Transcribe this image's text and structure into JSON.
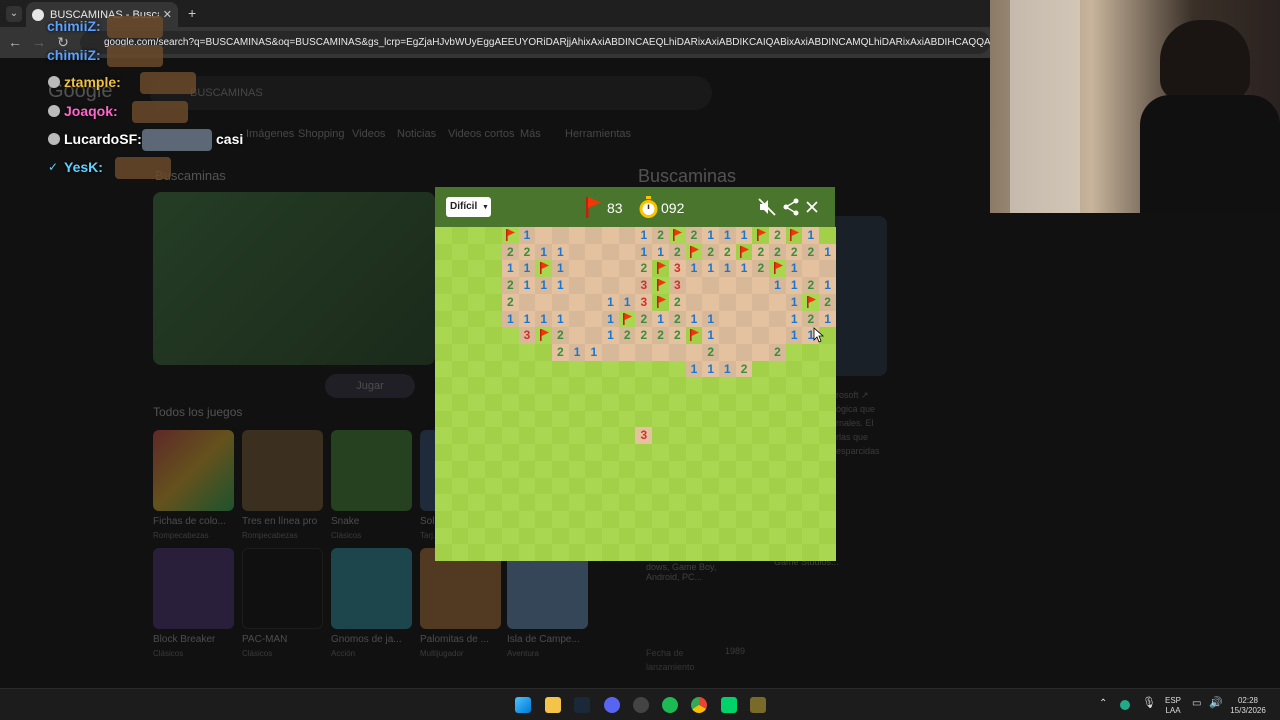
{
  "browser": {
    "tab_title": "BUSCAMINAS - Buscar con Google",
    "url": "google.com/search?q=BUSCAMINAS&oq=BUSCAMINAS&gs_lcrp=EgZjaHJvbWUyEggAEEUYORiDARjjAhixAxiABDINCAEQLhiDARixAxiABDIKCAIQABixAxiABDINCAMQLhiDARixAxiABDIHCAQQABiABDIHCAUQABiABDIH"
  },
  "google": {
    "logo": "Google",
    "query": "BUSCAMINAS",
    "tabs": [
      "Imágenes",
      "Shopping",
      "Videos",
      "Noticias",
      "Videos cortos",
      "Más",
      "Herramientas"
    ],
    "game_title": "Buscaminas",
    "play_label": "Jugar",
    "all_games_label": "Todos los juegos",
    "games": [
      {
        "name": "Fichas de colo...",
        "sub": "Rompecabezas"
      },
      {
        "name": "Tres en línea pro",
        "sub": "Rompecabezas"
      },
      {
        "name": "Snake",
        "sub": "Clásicos"
      },
      {
        "name": "Sol...",
        "sub": "Tarj..."
      },
      {
        "name": "Block Breaker",
        "sub": "Clásicos"
      },
      {
        "name": "PAC-MAN",
        "sub": "Clásicos"
      },
      {
        "name": "Gnomos de ja...",
        "sub": "Acción"
      },
      {
        "name": "Palomitas de ...",
        "sub": "Multijugador"
      },
      {
        "name": "Isla de Campe...",
        "sub": "Aventura"
      }
    ],
    "kp_title": "Buscaminas",
    "kp_info": "rosoft ↗\nógica que\nrnales. El\nrlas que\nesparcidas",
    "kp_platforms": "dows, Game Boy, Android, PC...",
    "kp_dev": "crosoft, Xbox Game Studios...",
    "kp_date_label": "Fecha de\nlanzamiento",
    "kp_date": "1989"
  },
  "minesweeper": {
    "difficulty": "Difícil",
    "flags": "83",
    "timer": "092",
    "colors": {
      "header": "#4a752c",
      "grass_a": "#aad751",
      "grass_b": "#a2d149",
      "dirt_a": "#e5c29f",
      "dirt_b": "#d7b899"
    },
    "revealed_rows": [
      {
        "row": 0,
        "start": 4,
        "cells": "F1......12F2111F2F1"
      },
      {
        "row": 1,
        "start": 4,
        "cells": "2211....112F22F22221"
      },
      {
        "row": 2,
        "start": 4,
        "cells": "11F1....2F311112F1.."
      },
      {
        "row": 3,
        "start": 4,
        "cells": "2111....3F3.....11211"
      },
      {
        "row": 4,
        "start": 4,
        "cells": "2.....113F2......1F2F"
      },
      {
        "row": 5,
        "start": 4,
        "cells": "1111..1F21211....121"
      },
      {
        "row": 6,
        "start": 5,
        "cells": "3F2..12222F1....11"
      },
      {
        "row": 7,
        "start": 7,
        "cells": "211......2...2"
      },
      {
        "row": 8,
        "start": 15,
        "cells": "1112"
      },
      {
        "row": 12,
        "start": 12,
        "cells": "3"
      }
    ]
  },
  "chat": [
    {
      "user": "chimiiZ",
      "color": "#5aa0ff",
      "text": ""
    },
    {
      "user": "chimiiZ",
      "color": "#5aa0ff",
      "text": ""
    },
    {
      "user": "ztample",
      "color": "#f0c040",
      "text": ""
    },
    {
      "user": "Joaqok",
      "color": "#ff66cc",
      "text": ""
    },
    {
      "user": "LucardoSF",
      "color": "#ffffff",
      "text": "casi"
    },
    {
      "user": "YesK",
      "color": "#5fd0ff",
      "text": ""
    }
  ],
  "taskbar": {
    "lang": "ESP",
    "layout": "LAA",
    "time": "02:28",
    "date": "15/3/2026"
  }
}
